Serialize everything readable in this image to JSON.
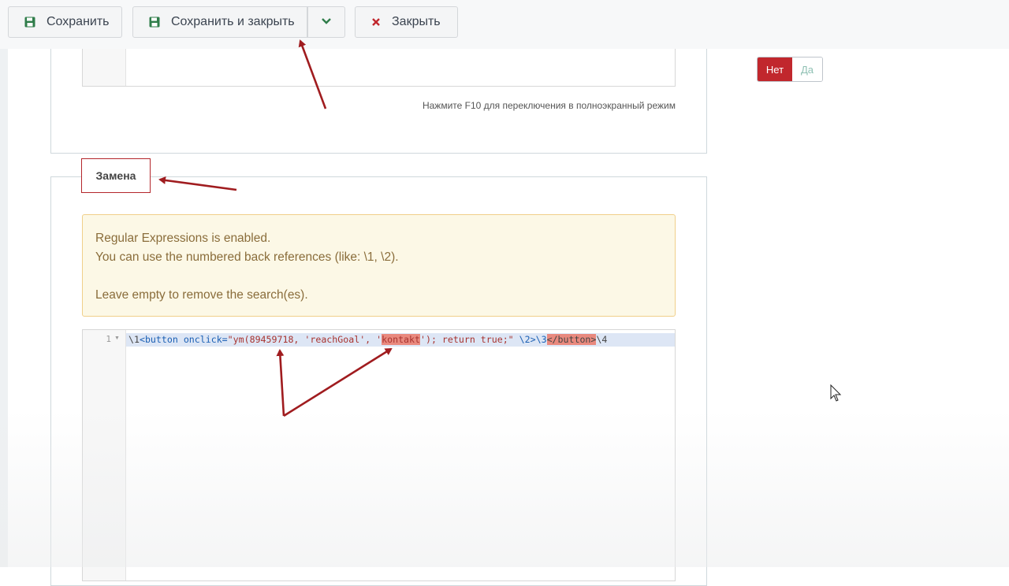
{
  "toolbar": {
    "save_label": "Сохранить",
    "save_close_label": "Сохранить и закрыть",
    "close_label": "Закрыть"
  },
  "editor_top": {
    "hint": "Нажмите F10 для переключения в полноэкранный режим"
  },
  "replace_section": {
    "legend": "Замена",
    "alert_lines": [
      "Regular Expressions is enabled.",
      "You can use the numbered back references (like: \\1, \\2).",
      "Leave empty to remove the search(es)."
    ],
    "editor": {
      "line_number": "1",
      "code_segments": [
        "\\1",
        "<button",
        " onclick=",
        "\"ym(89459718, 'reachGoal', '",
        "kontakt",
        "'); return true;\"",
        " \\2>\\3",
        "</button>",
        "\\4"
      ]
    }
  },
  "toggle": {
    "no_label": "Нет",
    "yes_label": "Да",
    "selected": "Нет"
  },
  "colors": {
    "accent_red": "#c1272d",
    "annotation_arrow": "#a01c1f",
    "alert_bg": "#fcf8e6",
    "alert_text": "#8a6d3b"
  },
  "icons": [
    "save-icon",
    "chevron-down-icon",
    "close-icon",
    "mouse-cursor-icon"
  ]
}
